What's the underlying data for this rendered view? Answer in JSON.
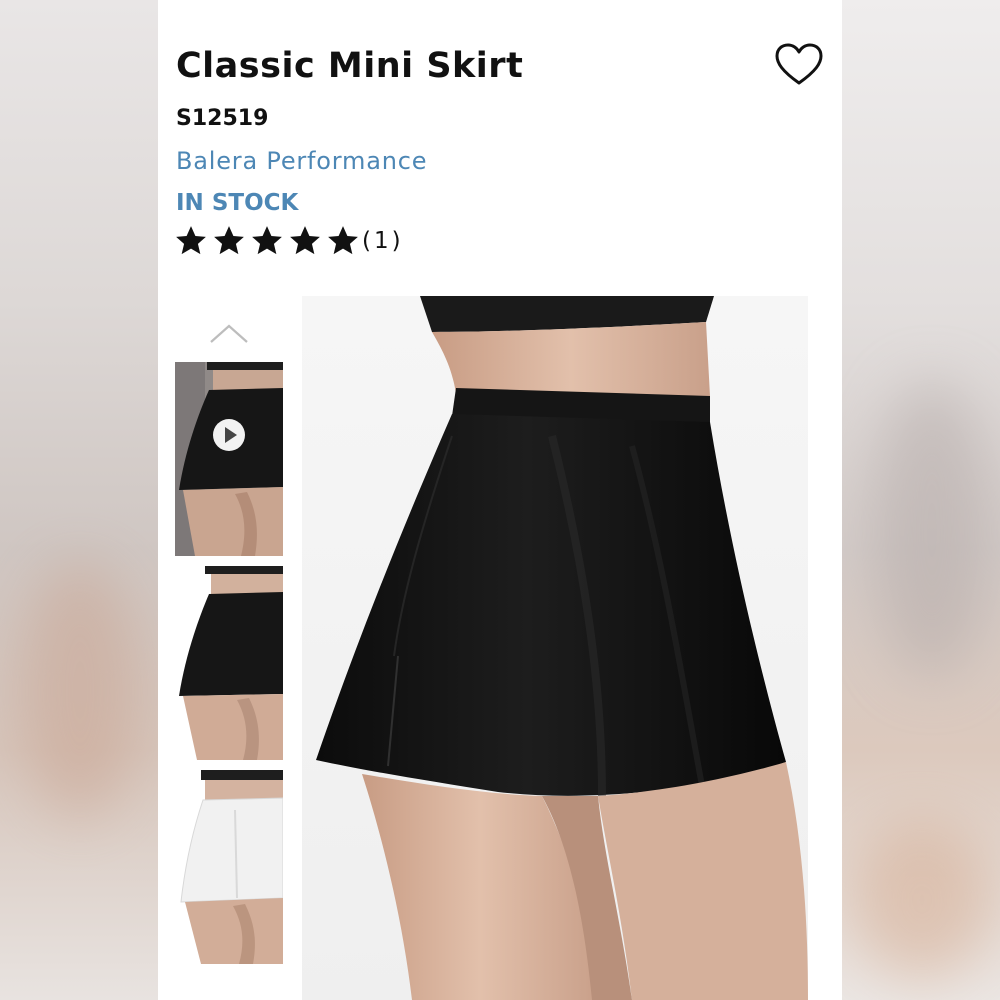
{
  "product": {
    "title": "Classic Mini Skirt",
    "sku": "S12519",
    "brand": "Balera Performance",
    "stock_status": "IN STOCK",
    "rating": {
      "stars": 5,
      "count_label": "(1)"
    }
  },
  "gallery": {
    "thumbnails": [
      {
        "name": "thumbnail-video",
        "color": "black",
        "has_video": true
      },
      {
        "name": "thumbnail-black",
        "color": "black",
        "has_video": false
      },
      {
        "name": "thumbnail-white",
        "color": "white",
        "has_video": false
      }
    ],
    "main_image": "black-mini-skirt-photo"
  },
  "icons": {
    "wishlist": "heart-icon",
    "scroll_up": "chevron-up-icon",
    "play": "play-icon",
    "star": "star-icon"
  },
  "colors": {
    "accent": "#4d87b5",
    "text": "#111111",
    "background": "#ffffff"
  }
}
